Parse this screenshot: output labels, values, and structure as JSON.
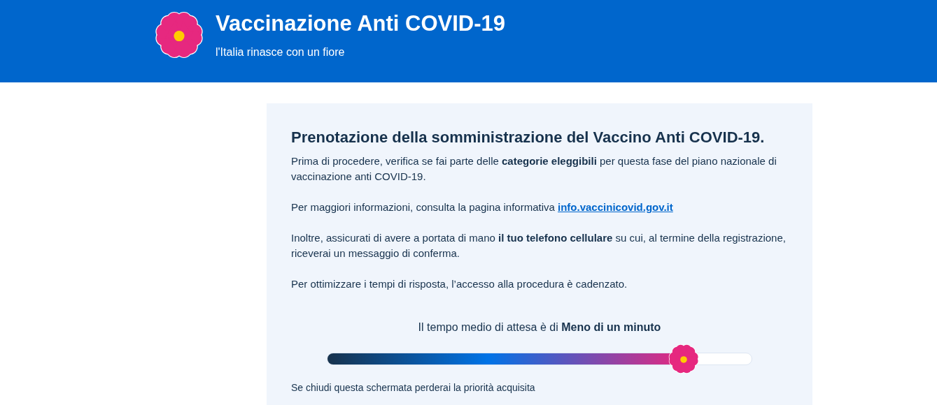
{
  "header": {
    "title": "Vaccinazione Anti COVID-19",
    "subtitle": "l'Italia rinasce con un fiore"
  },
  "card": {
    "title": "Prenotazione della somministrazione del Vaccino Anti COVID-19.",
    "paragraphs": [
      {
        "kind": "text",
        "text": "Prima di procedere, verifica se fai parte delle **categorie eleggibili** per questa fase del piano nazionale di vaccinazione anti COVID-19."
      },
      {
        "kind": "link",
        "text": "Per maggiori informazioni, consulta la pagina informativa",
        "link": "info.vaccinicovid.gov.it"
      },
      {
        "kind": "text",
        "text": "Inoltre, assicurati di avere a portata di mano **il tuo telefono cellulare** su cui, al termine della registrazione, riceverai un messaggio di conferma."
      },
      {
        "kind": "text",
        "text": "Per ottimizzare i tempi di risposta, l’accesso alla procedura è cadenzato."
      }
    ],
    "wait": {
      "text": "Il tempo medio di attesa è di **Meno di un minuto**"
    },
    "progress": {
      "level": 0.84
    },
    "footer_note": "Se chiudi questa schermata perderai la priorità acquisita"
  }
}
